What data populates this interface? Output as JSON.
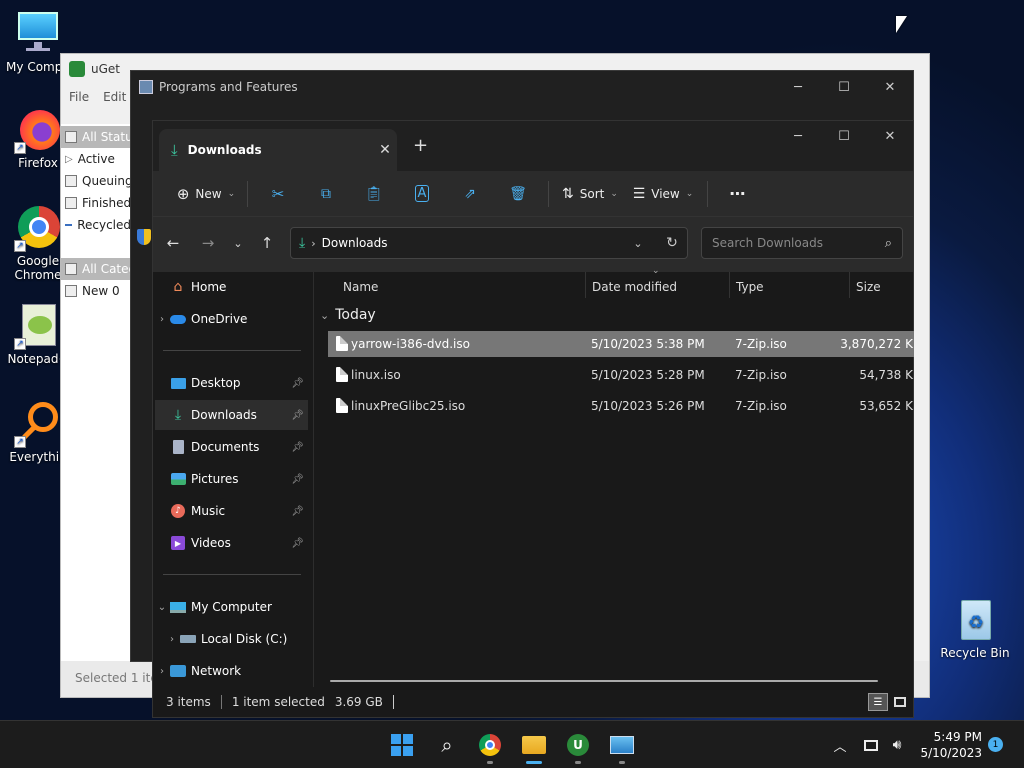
{
  "desktop": {
    "icons": [
      {
        "label": "My Compu",
        "icon": "monitor-icon"
      },
      {
        "label": "Firefox",
        "icon": "firefox-icon"
      },
      {
        "label": "Google Chrome",
        "icon": "chrome-icon"
      },
      {
        "label": "Notepad+",
        "icon": "notepadpp-icon"
      },
      {
        "label": "Everythin",
        "icon": "everything-search-icon"
      },
      {
        "label": "Recycle Bin",
        "icon": "recycle-bin-icon"
      }
    ]
  },
  "uget": {
    "title": "uGet",
    "menu": [
      "File",
      "Edit"
    ],
    "status_categories": [
      "All Statu",
      "Active",
      "Queuing",
      "Finished",
      "Recycled"
    ],
    "categories": [
      "All Categ",
      "New 0"
    ],
    "status": "Selected 1 ite"
  },
  "programs": {
    "title": "Programs and Features"
  },
  "explorer": {
    "tab_title": "Downloads",
    "toolbar": {
      "new": "New",
      "sort": "Sort",
      "view": "View"
    },
    "address": "Downloads",
    "search_placeholder": "Search Downloads",
    "nav": {
      "home": "Home",
      "onedrive": "OneDrive",
      "desktop": "Desktop",
      "downloads": "Downloads",
      "documents": "Documents",
      "pictures": "Pictures",
      "music": "Music",
      "videos": "Videos",
      "my_computer": "My Computer",
      "local_disk": "Local Disk (C:)",
      "network": "Network"
    },
    "columns": {
      "name": "Name",
      "date": "Date modified",
      "type": "Type",
      "size": "Size"
    },
    "group": "Today",
    "files": [
      {
        "name": "yarrow-i386-dvd.iso",
        "date": "5/10/2023 5:38 PM",
        "type": "7-Zip.iso",
        "size": "3,870,272 K"
      },
      {
        "name": "linux.iso",
        "date": "5/10/2023 5:28 PM",
        "type": "7-Zip.iso",
        "size": "54,738 K"
      },
      {
        "name": "linuxPreGlibc25.iso",
        "date": "5/10/2023 5:26 PM",
        "type": "7-Zip.iso",
        "size": "53,652 K"
      }
    ],
    "status": {
      "items": "3 items",
      "selected": "1 item selected",
      "size": "3.69 GB"
    }
  },
  "taskbar": {
    "time": "5:49 PM",
    "date": "5/10/2023",
    "notification_count": "1"
  },
  "colors": {
    "accent": "#4ab0f0",
    "selection": "#777777"
  }
}
